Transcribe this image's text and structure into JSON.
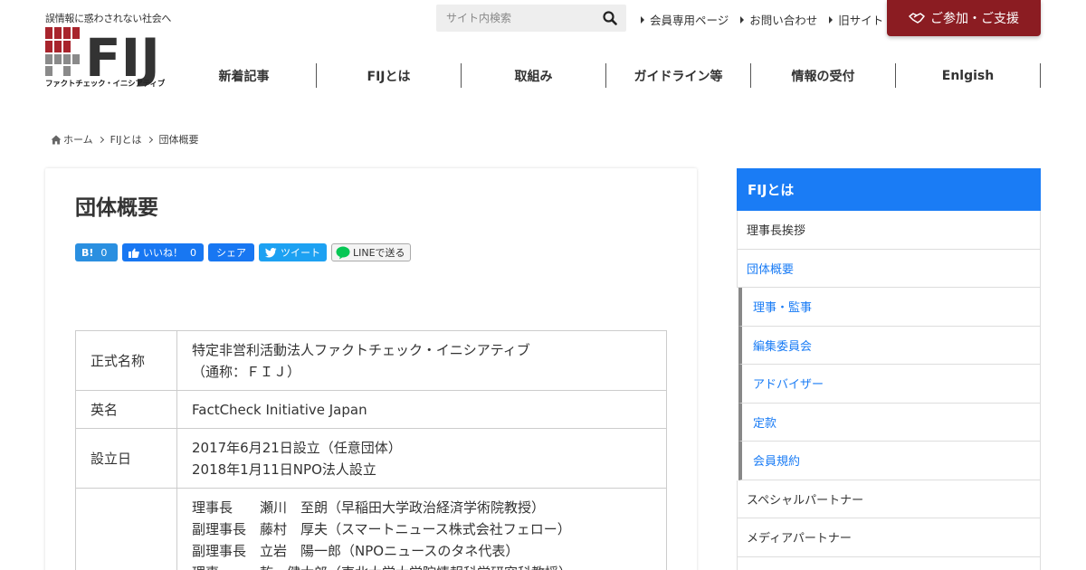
{
  "header": {
    "tagline": "誤情報に惑わされない社会へ",
    "logo_text": "FIJ",
    "logo_sub": "ファクトチェック・イニシアティブ",
    "search_placeholder": "サイト内検索",
    "top_links": [
      "会員専用ページ",
      "お問い合わせ",
      "旧サイト"
    ],
    "join_label": "ご参加・ご支援",
    "nav": [
      "新着記事",
      "FIJとは",
      "取組み",
      "ガイドライン等",
      "情報の受付",
      "Enlgish"
    ]
  },
  "breadcrumb": [
    "ホーム",
    "FIJとは",
    "団体概要"
  ],
  "page": {
    "title": "団体概要",
    "share": {
      "hatena_label": "B!",
      "hatena_count": "0",
      "like_label": "いいね！",
      "like_count": "0",
      "fb_share": "シェア",
      "tweet": "ツイート",
      "line": "LINEで送る"
    },
    "table": [
      {
        "head": "正式名称",
        "lines": [
          "特定非営利活動法人ファクトチェック・イニシアティブ",
          "（通称：ＦＩＪ）"
        ]
      },
      {
        "head": "英名",
        "lines": [
          "FactCheck Initiative Japan"
        ]
      },
      {
        "head": "設立日",
        "lines": [
          "2017年6月21日設立（任意団体）",
          "2018年1月11日NPO法人設立"
        ]
      },
      {
        "head": "",
        "lines": [
          "理事長　　瀬川　至朗（早稲田大学政治経済学術院教授）",
          "副理事長　藤村　厚夫（スマートニュース株式会社フェロー）",
          "副理事長　立岩　陽一郎（NPOニュースのタネ代表）",
          "理事　　　乾　健太郎（東北大学大学院情報科学研究科教授）"
        ]
      }
    ]
  },
  "sidebar": {
    "title": "FIJとは",
    "items": [
      {
        "label": "理事長挨拶",
        "type": "normal"
      },
      {
        "label": "団体概要",
        "type": "current"
      },
      {
        "label": "理事・監事",
        "type": "sub"
      },
      {
        "label": "編集委員会",
        "type": "sub"
      },
      {
        "label": "アドバイザー",
        "type": "sub"
      },
      {
        "label": "定款",
        "type": "sub"
      },
      {
        "label": "会員規約",
        "type": "sub"
      },
      {
        "label": "スペシャルパートナー",
        "type": "normal"
      },
      {
        "label": "メディアパートナー",
        "type": "normal"
      },
      {
        "label": "",
        "type": "normal"
      }
    ]
  },
  "colors": {
    "accent": "#1a7cf5",
    "join_bg": "#8b1c22",
    "logo_red": "#a8242c",
    "logo_dark": "#333333"
  }
}
